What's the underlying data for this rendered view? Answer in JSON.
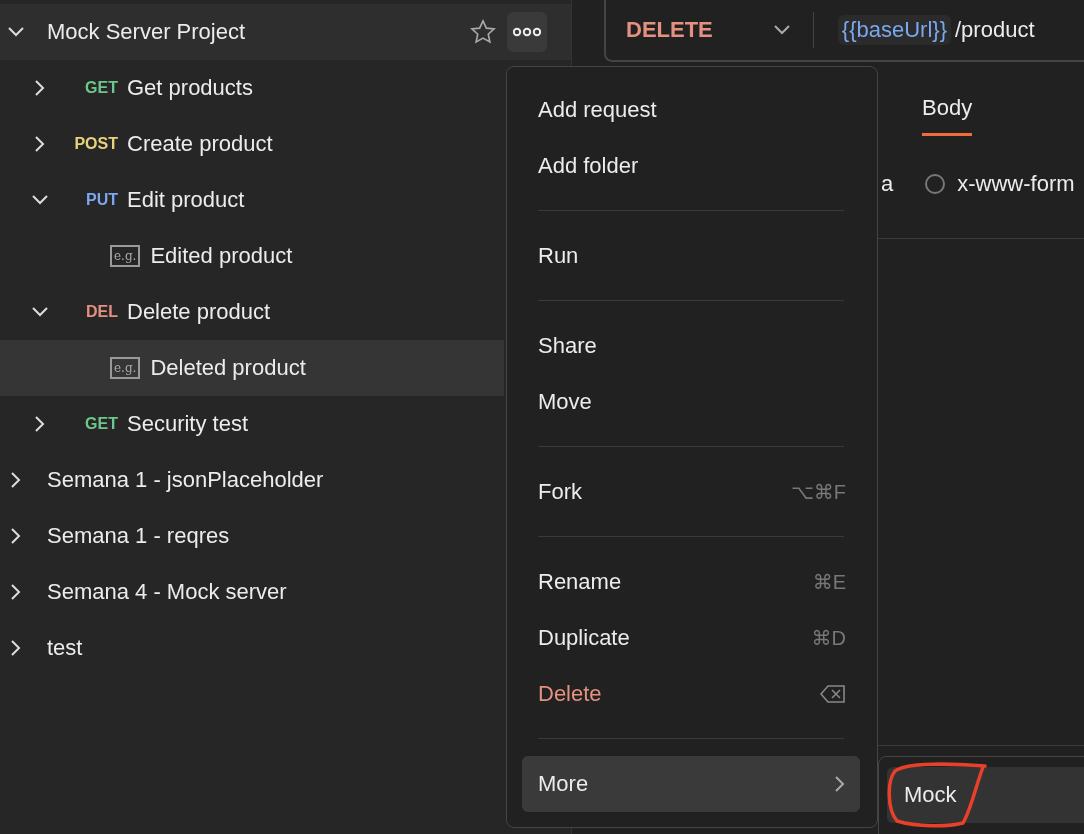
{
  "sidebar": {
    "tree": [
      {
        "kind": "collection",
        "name": "Mock Server Project",
        "expanded": true,
        "hovered": true,
        "children": [
          {
            "kind": "request",
            "name": "Get products",
            "method": {
              "label": "GET",
              "color": "#6bc88a"
            },
            "expanded": false,
            "selected": false
          },
          {
            "kind": "request",
            "name": "Create product",
            "method": {
              "label": "POST",
              "color": "#e8d27a"
            },
            "expanded": false,
            "selected": false
          },
          {
            "kind": "request",
            "name": "Edit product",
            "method": {
              "label": "PUT",
              "color": "#7aa7ee"
            },
            "expanded": true,
            "selected": false,
            "children": [
              {
                "kind": "example",
                "name": "Edited product",
                "badge": "e.g.",
                "selected": false
              }
            ]
          },
          {
            "kind": "request",
            "name": "Delete product",
            "method": {
              "label": "DEL",
              "color": "#e4917f"
            },
            "expanded": true,
            "selected": false,
            "children": [
              {
                "kind": "example",
                "name": "Deleted product",
                "badge": "e.g.",
                "selected": true
              }
            ]
          },
          {
            "kind": "request",
            "name": "Security test",
            "method": {
              "label": "GET",
              "color": "#6bc88a"
            },
            "expanded": false,
            "selected": false
          }
        ]
      },
      {
        "kind": "collection",
        "name": "Semana 1 - jsonPlaceholder",
        "expanded": false,
        "selected": false,
        "hovered": false
      },
      {
        "kind": "collection",
        "name": "Semana 1 - reqres",
        "expanded": false,
        "selected": false,
        "hovered": false
      },
      {
        "kind": "collection",
        "name": "Semana 4 - Mock server",
        "expanded": false,
        "selected": false,
        "hovered": false
      },
      {
        "kind": "collection",
        "name": "test",
        "expanded": false,
        "selected": false,
        "hovered": false
      }
    ]
  },
  "request": {
    "method": "DELETE",
    "url_variable": "{{baseUrl}}",
    "url_path": "/product"
  },
  "tabs": [
    {
      "label": "Body",
      "selected": true
    }
  ],
  "body_options": [
    {
      "kind": "cut",
      "label": "a"
    },
    {
      "kind": "radio",
      "label": "x-www-form",
      "selected": false
    }
  ],
  "context_menu": {
    "groups": [
      [
        {
          "kind": "normal",
          "label": "Add request",
          "selected": false
        },
        {
          "kind": "normal",
          "label": "Add folder",
          "selected": false
        }
      ],
      [
        {
          "kind": "normal",
          "label": "Run",
          "selected": false
        }
      ],
      [
        {
          "kind": "normal",
          "label": "Share",
          "selected": false
        },
        {
          "kind": "normal",
          "label": "Move",
          "selected": false
        }
      ],
      [
        {
          "kind": "normal",
          "label": "Fork",
          "shortcut": "⌥⌘F",
          "selected": false
        }
      ],
      [
        {
          "kind": "normal",
          "label": "Rename",
          "shortcut": "⌘E",
          "selected": false
        },
        {
          "kind": "normal",
          "label": "Duplicate",
          "shortcut": "⌘D",
          "selected": false
        },
        {
          "kind": "danger",
          "label": "Delete",
          "selected": false
        }
      ],
      [
        {
          "kind": "submenu",
          "label": "More",
          "selected": true
        }
      ]
    ]
  },
  "submenu": {
    "items": [
      {
        "label": "Mock",
        "selected": true,
        "circled": true
      }
    ]
  }
}
